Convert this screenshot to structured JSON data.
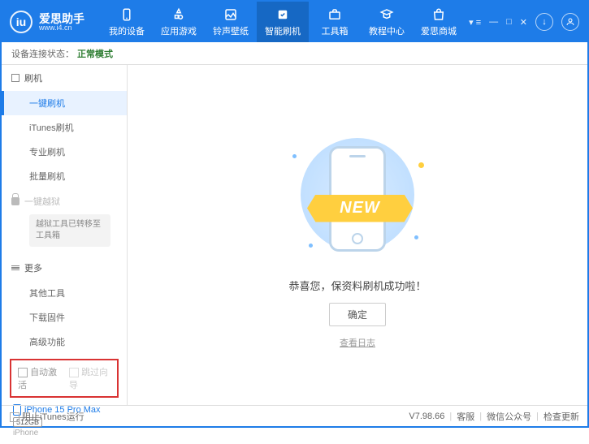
{
  "header": {
    "logo_char": "iu",
    "title": "爱思助手",
    "url": "www.i4.cn",
    "nav": [
      "我的设备",
      "应用游戏",
      "铃声壁纸",
      "智能刷机",
      "工具箱",
      "教程中心",
      "爱思商城"
    ],
    "active_nav": 3
  },
  "status": {
    "label": "设备连接状态：",
    "mode": "正常模式"
  },
  "sidebar": {
    "section1": "刷机",
    "items1": [
      "一键刷机",
      "iTunes刷机",
      "专业刷机",
      "批量刷机"
    ],
    "jailbreak": "一键越狱",
    "jailbreak_note": "越狱工具已转移至工具箱",
    "section_more": "更多",
    "items_more": [
      "其他工具",
      "下载固件",
      "高级功能"
    ],
    "checkbox1": "自动激活",
    "checkbox2": "跳过向导",
    "device_name": "iPhone 15 Pro Max",
    "device_storage": "512GB",
    "device_type": "iPhone"
  },
  "main": {
    "ribbon": "NEW",
    "success": "恭喜您，保资料刷机成功啦！",
    "ok": "确定",
    "log": "查看日志"
  },
  "footer": {
    "block_itunes": "阻止iTunes运行",
    "version": "V7.98.66",
    "links": [
      "客服",
      "微信公众号",
      "检查更新"
    ]
  }
}
